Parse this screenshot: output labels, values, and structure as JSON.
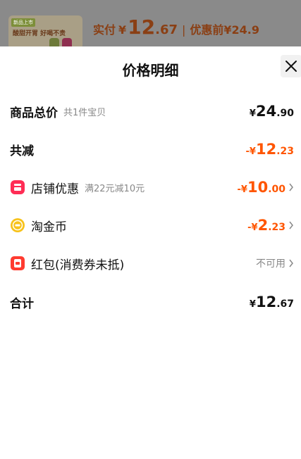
{
  "top_bar": {
    "thumb_tag": "新品上市",
    "thumb_text": "酸甜开胃 好喝不贵",
    "paid_label": "实付",
    "paid_yen": "¥",
    "paid_int": "12",
    "paid_dec": ".67",
    "separator": "|",
    "before_discount": "优惠前¥24.9"
  },
  "sheet": {
    "title": "价格明细"
  },
  "rows": {
    "total": {
      "label": "商品总价",
      "sub": "共1件宝贝",
      "yen": "¥",
      "int": "24",
      "dec": ".90"
    },
    "reduced": {
      "label": "共减",
      "yen": "-¥",
      "int": "12",
      "dec": ".23"
    },
    "shop_discount": {
      "label": "店铺优惠",
      "sub": "满22元减10元",
      "yen": "-¥",
      "int": "10",
      "dec": ".00"
    },
    "coins": {
      "label": "淘金币",
      "yen": "-¥",
      "int": "2",
      "dec": ".23"
    },
    "red_packet": {
      "label": "红包(消费券未抵)",
      "status": "不可用"
    },
    "sum": {
      "label": "合计",
      "yen": "¥",
      "int": "12",
      "dec": ".67"
    }
  },
  "colors": {
    "accent": "#ff5500",
    "shop_icon": "#ff2d55",
    "coin_icon": "#f7c21a",
    "red_packet_icon": "#ff3b30"
  },
  "icons": {
    "close": "close-icon",
    "shop": "shop-icon",
    "coin": "coin-icon",
    "red_packet": "red-packet-icon",
    "chevron": "chevron-right-icon"
  }
}
